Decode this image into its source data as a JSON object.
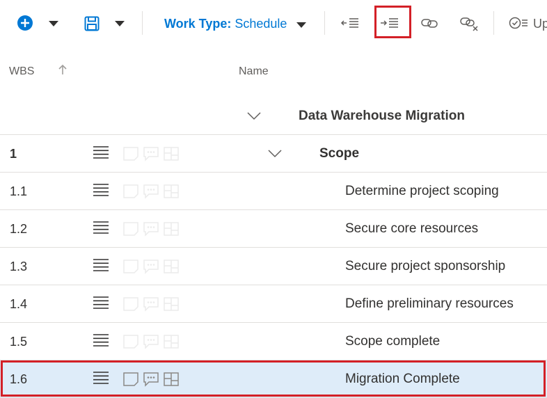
{
  "toolbar": {
    "add_icon": "plus-circle-icon",
    "save_icon": "save-icon",
    "work_type_label": "Work Type:",
    "work_type_value": "Schedule",
    "outdent_icon": "outdent-icon",
    "indent_icon": "indent-icon",
    "link_icon": "link-icon",
    "unlink_icon": "unlink-icon",
    "update_icon": "check-circle-icon",
    "update_label": "Up",
    "accent": "#0078d4",
    "highlight": "#d32027"
  },
  "columns": {
    "wbs": "WBS",
    "name": "Name"
  },
  "rows": [
    {
      "wbs": "",
      "name": "Data Warehouse Migration",
      "level": 0,
      "summary": true
    },
    {
      "wbs": "1",
      "name": "Scope",
      "level": 1,
      "summary": true
    },
    {
      "wbs": "1.1",
      "name": "Determine project scoping",
      "level": 2,
      "summary": false
    },
    {
      "wbs": "1.2",
      "name": "Secure core resources",
      "level": 2,
      "summary": false
    },
    {
      "wbs": "1.3",
      "name": "Secure project sponsorship",
      "level": 2,
      "summary": false
    },
    {
      "wbs": "1.4",
      "name": "Define preliminary resources",
      "level": 2,
      "summary": false
    },
    {
      "wbs": "1.5",
      "name": "Scope complete",
      "level": 2,
      "summary": false
    },
    {
      "wbs": "1.6",
      "name": "Migration Complete",
      "level": 2,
      "summary": false,
      "selected": true
    }
  ],
  "selected_color": "#deecf9"
}
